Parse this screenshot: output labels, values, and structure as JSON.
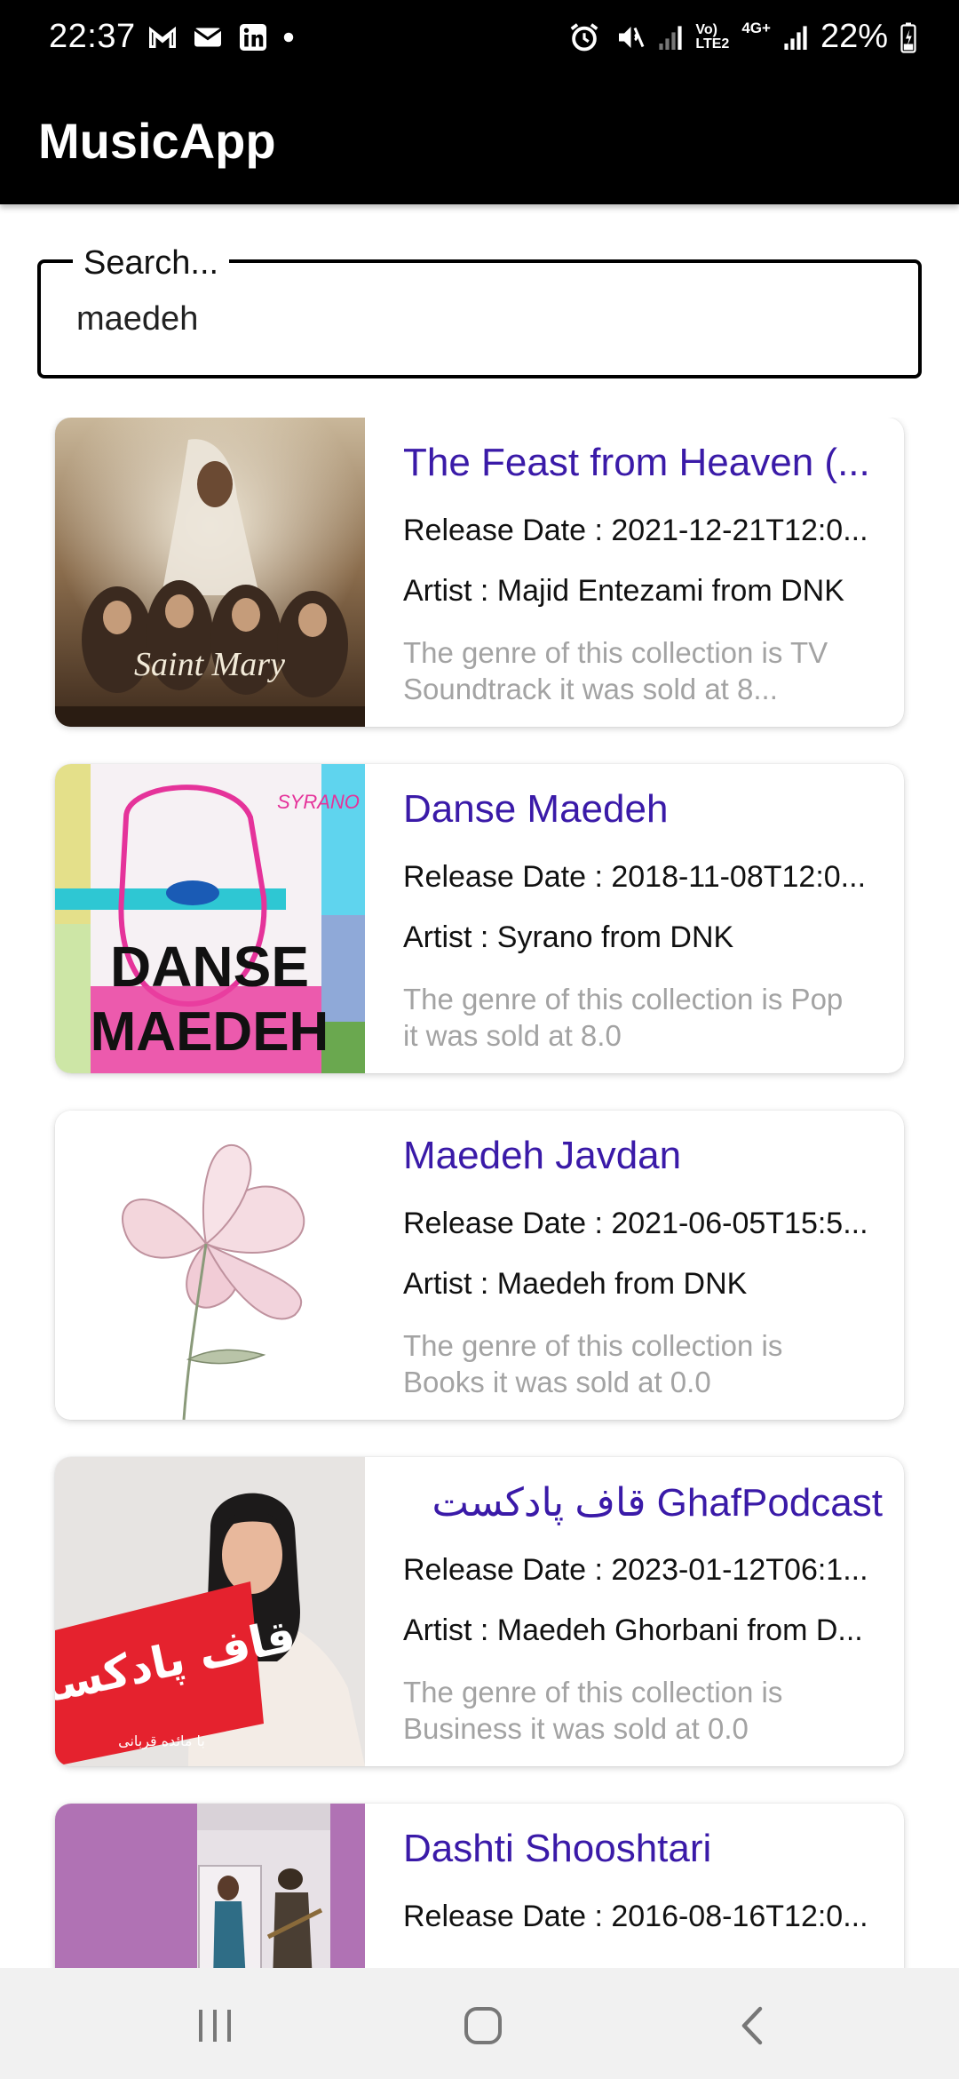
{
  "status_bar": {
    "time": "22:37",
    "battery_percent": "22%",
    "network_label_top": "Vo)",
    "network_label_bottom": "LTE2",
    "network_type": "4G+",
    "left_icons": [
      "gmail-icon",
      "mail-icon",
      "linkedin-icon",
      "dot-icon"
    ],
    "right_icons": [
      "alarm-icon",
      "mute-icon",
      "signal-icon",
      "signal-icon",
      "battery-icon"
    ]
  },
  "app_bar": {
    "title": "MusicApp"
  },
  "search": {
    "label": "Search...",
    "value": "maedeh"
  },
  "colors": {
    "title_accent": "#3a1aa8",
    "genre_text": "#a3a3a3",
    "app_bar": "#000000"
  },
  "results": [
    {
      "title": "The Feast from Heaven (...",
      "release": "Release Date : 2021-12-21T12:0...",
      "artist": "Artist : Majid Entezami from DNK",
      "genre": "The genre of this collection is TV Soundtrack it was sold at 8...",
      "art": "saint-mary-cover",
      "art_text": "Saint Mary"
    },
    {
      "title": "Danse Maedeh",
      "release": "Release Date : 2018-11-08T12:0...",
      "artist": "Artist : Syrano from DNK",
      "genre": "The genre of this collection is Pop it was sold at 8.0",
      "art": "danse-maedeh-cover",
      "art_text": "DANSE MAEDEH",
      "art_brand": "SYRANO"
    },
    {
      "title": "Maedeh Javdan",
      "release": "Release Date : 2021-06-05T15:5...",
      "artist": "Artist : Maedeh from DNK",
      "genre": "The genre of this collection is Books it was sold at 0.0",
      "art": "flower-cover"
    },
    {
      "title": "GhafPodcast قاف پادکست",
      "release": "Release Date : 2023-01-12T06:1...",
      "artist": "Artist : Maedeh Ghorbani from D...",
      "genre": "The genre of this collection is Business it was sold at 0.0",
      "art": "ghaf-podcast-cover",
      "art_text": "قاف پادکست",
      "art_subtext": "با مائده قربانی"
    },
    {
      "title": "Dashti Shooshtari",
      "release": "Release Date : 2016-08-16T12:0...",
      "artist": "",
      "genre": "",
      "art": "dashti-shooshtari-cover"
    }
  ],
  "nav_bar": {
    "buttons": [
      "recents-icon",
      "home-icon",
      "back-icon"
    ]
  }
}
